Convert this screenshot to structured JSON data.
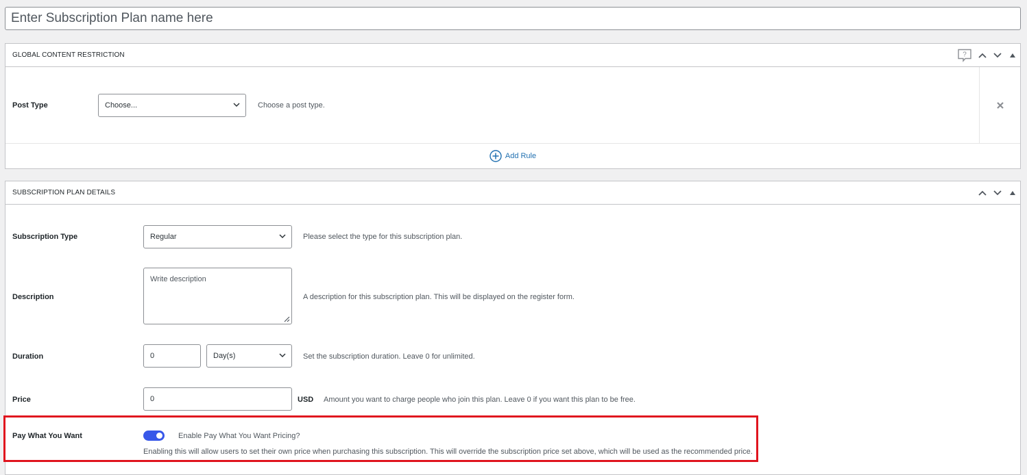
{
  "title_input": {
    "placeholder": "Enter Subscription Plan name here"
  },
  "global_content_restriction": {
    "title": "GLOBAL CONTENT RESTRICTION",
    "icons": [
      "help-icon",
      "chevron-up-icon",
      "chevron-down-icon",
      "collapse-toggle-icon"
    ],
    "rule": {
      "label": "Post Type",
      "select_value": "Choose...",
      "hint": "Choose a post type."
    },
    "add_rule_label": "Add Rule"
  },
  "subscription_plan_details": {
    "title": "SUBSCRIPTION PLAN DETAILS",
    "icons": [
      "chevron-up-icon",
      "chevron-down-icon",
      "collapse-toggle-icon"
    ],
    "subscription_type": {
      "label": "Subscription Type",
      "value": "Regular",
      "hint": "Please select the type for this subscription plan."
    },
    "description": {
      "label": "Description",
      "placeholder": "Write description",
      "hint": "A description for this subscription plan. This will be displayed on the register form."
    },
    "duration": {
      "label": "Duration",
      "value": "0",
      "unit": "Day(s)",
      "hint": "Set the subscription duration. Leave 0 for unlimited."
    },
    "price": {
      "label": "Price",
      "value": "0",
      "currency": "USD",
      "hint": "Amount you want to charge people who join this plan. Leave 0 if you want this plan to be free."
    },
    "pay_what_you_want": {
      "label": "Pay What You Want",
      "enabled": true,
      "toggle_label": "Enable Pay What You Want Pricing?",
      "hint": "Enabling this will allow users to set their own price when purchasing this subscription. This will override the subscription price set above, which will be used as the recommended price."
    }
  },
  "colors": {
    "accent": "#2271b1",
    "toggle_on": "#3858e9",
    "highlight": "#e0141e"
  }
}
